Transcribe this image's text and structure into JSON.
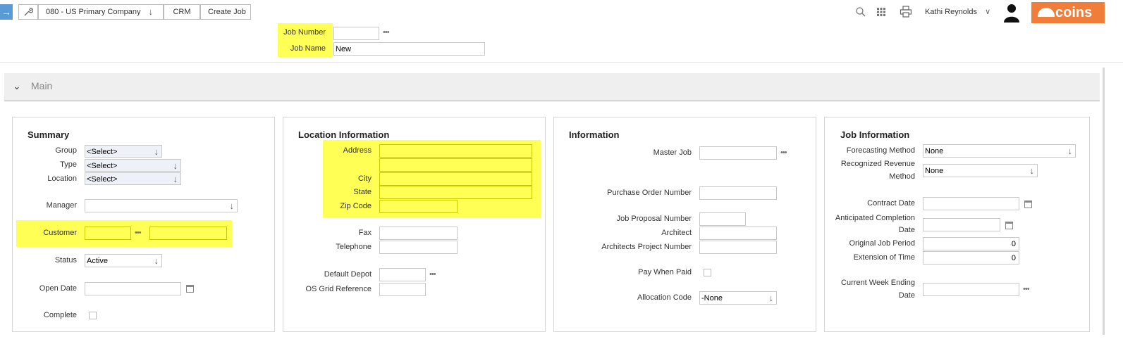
{
  "breadcrumb": {
    "company": "080 - US Primary Company",
    "module": "CRM",
    "page": "Create Job"
  },
  "header": {
    "user_name": "Kathi Reynolds",
    "logo_text": "coins",
    "job_number_label": "Job Number",
    "job_number_value": "",
    "job_name_label": "Job Name",
    "job_name_value": "New"
  },
  "section": {
    "title": "Main"
  },
  "summary": {
    "title": "Summary",
    "group_label": "Group",
    "group_value": "<Select>",
    "type_label": "Type",
    "type_value": "<Select>",
    "location_label": "Location",
    "location_value": "<Select>",
    "manager_label": "Manager",
    "manager_value": "",
    "customer_label": "Customer",
    "customer_code": "",
    "customer_name": "",
    "status_label": "Status",
    "status_value": "Active",
    "open_date_label": "Open Date",
    "open_date_value": "",
    "complete_label": "Complete"
  },
  "location": {
    "title": "Location Information",
    "address_label": "Address",
    "address_line1": "",
    "address_line2": "",
    "city_label": "City",
    "city_value": "",
    "state_label": "State",
    "state_value": "",
    "zip_label": "Zip Code",
    "zip_value": "",
    "fax_label": "Fax",
    "fax_value": "",
    "telephone_label": "Telephone",
    "telephone_value": "",
    "default_depot_label": "Default Depot",
    "default_depot_value": "",
    "os_grid_label": "OS Grid Reference",
    "os_grid_value": ""
  },
  "information": {
    "title": "Information",
    "master_job_label": "Master Job",
    "master_job_value": "",
    "po_number_label": "Purchase Order Number",
    "po_number_value": "",
    "job_proposal_label": "Job Proposal Number",
    "job_proposal_value": "",
    "architect_label": "Architect",
    "architect_value": "",
    "architect_project_label": "Architects Project Number",
    "architect_project_value": "",
    "pay_when_paid_label": "Pay When Paid",
    "allocation_code_label": "Allocation Code",
    "allocation_code_value": "-None"
  },
  "job_info": {
    "title": "Job Information",
    "forecasting_label": "Forecasting Method",
    "forecasting_value": "None",
    "recognized_revenue_label_1": "Recognized Revenue",
    "recognized_revenue_label_2": "Method",
    "recognized_revenue_value": "None",
    "contract_date_label": "Contract Date",
    "contract_date_value": "",
    "anticipated_label_1": "Anticipated Completion",
    "anticipated_label_2": "Date",
    "anticipated_value": "",
    "original_period_label": "Original Job Period",
    "original_period_value": "0",
    "extension_label": "Extension of Time",
    "extension_value": "0",
    "current_week_label_1": "Current Week Ending",
    "current_week_label_2": "Date",
    "current_week_value": ""
  },
  "colors": {
    "highlight": "#ffff55",
    "brand": "#f07d3a",
    "menu_button": "#5b9bd5"
  },
  "icons": [
    "menu-arrow-icon",
    "wrench-icon",
    "chevron-down-icon",
    "search-icon",
    "apps-grid-icon",
    "print-icon",
    "user-avatar-icon",
    "ellipsis-icon",
    "calendar-icon"
  ]
}
